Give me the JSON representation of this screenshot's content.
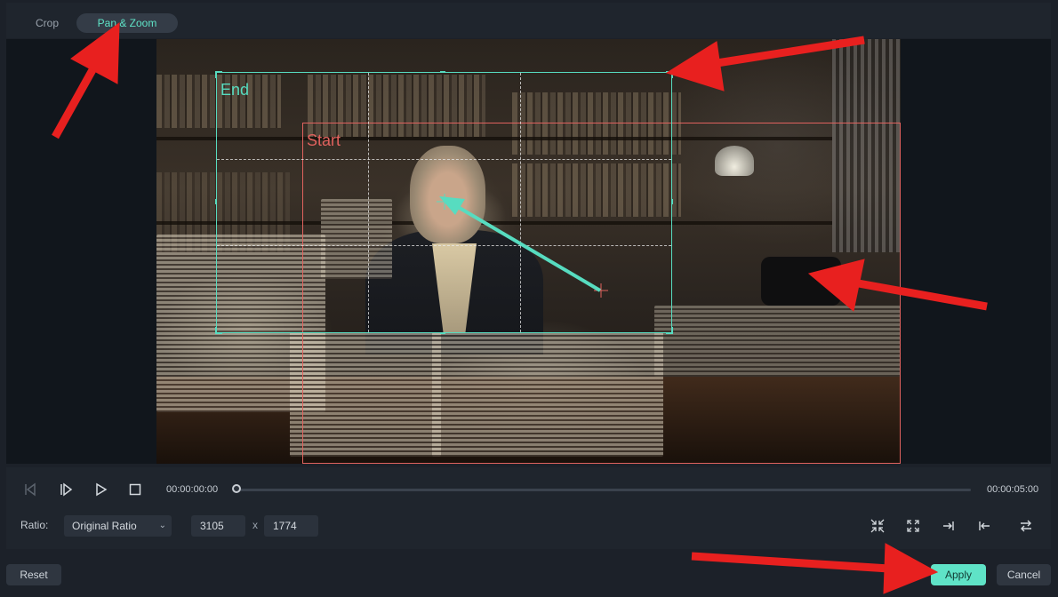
{
  "tabs": [
    {
      "label": "Crop",
      "active": false
    },
    {
      "label": "Pan & Zoom",
      "active": true
    }
  ],
  "preview": {
    "end_label": "End",
    "start_label": "Start"
  },
  "playback": {
    "current_time": "00:00:00:00",
    "total_time": "00:00:05:00",
    "progress": 0
  },
  "ratio": {
    "label": "Ratio:",
    "selected": "Original Ratio",
    "width": "3105",
    "separator": "x",
    "height": "1774"
  },
  "buttons": {
    "reset": "Reset",
    "apply": "Apply",
    "cancel": "Cancel"
  },
  "icons": {
    "prev_frame": "step-back-icon",
    "next_frame": "step-forward-icon",
    "play": "play-icon",
    "stop": "stop-icon",
    "tools": [
      "fit-inward-icon",
      "fit-outward-icon",
      "align-right-icon",
      "align-left-icon",
      "swap-icon"
    ]
  },
  "colors": {
    "accent": "#5fe3c7",
    "end_box": "#57dcc0",
    "start_box": "#e0625e",
    "annotation_arrow": "#e8201f"
  }
}
